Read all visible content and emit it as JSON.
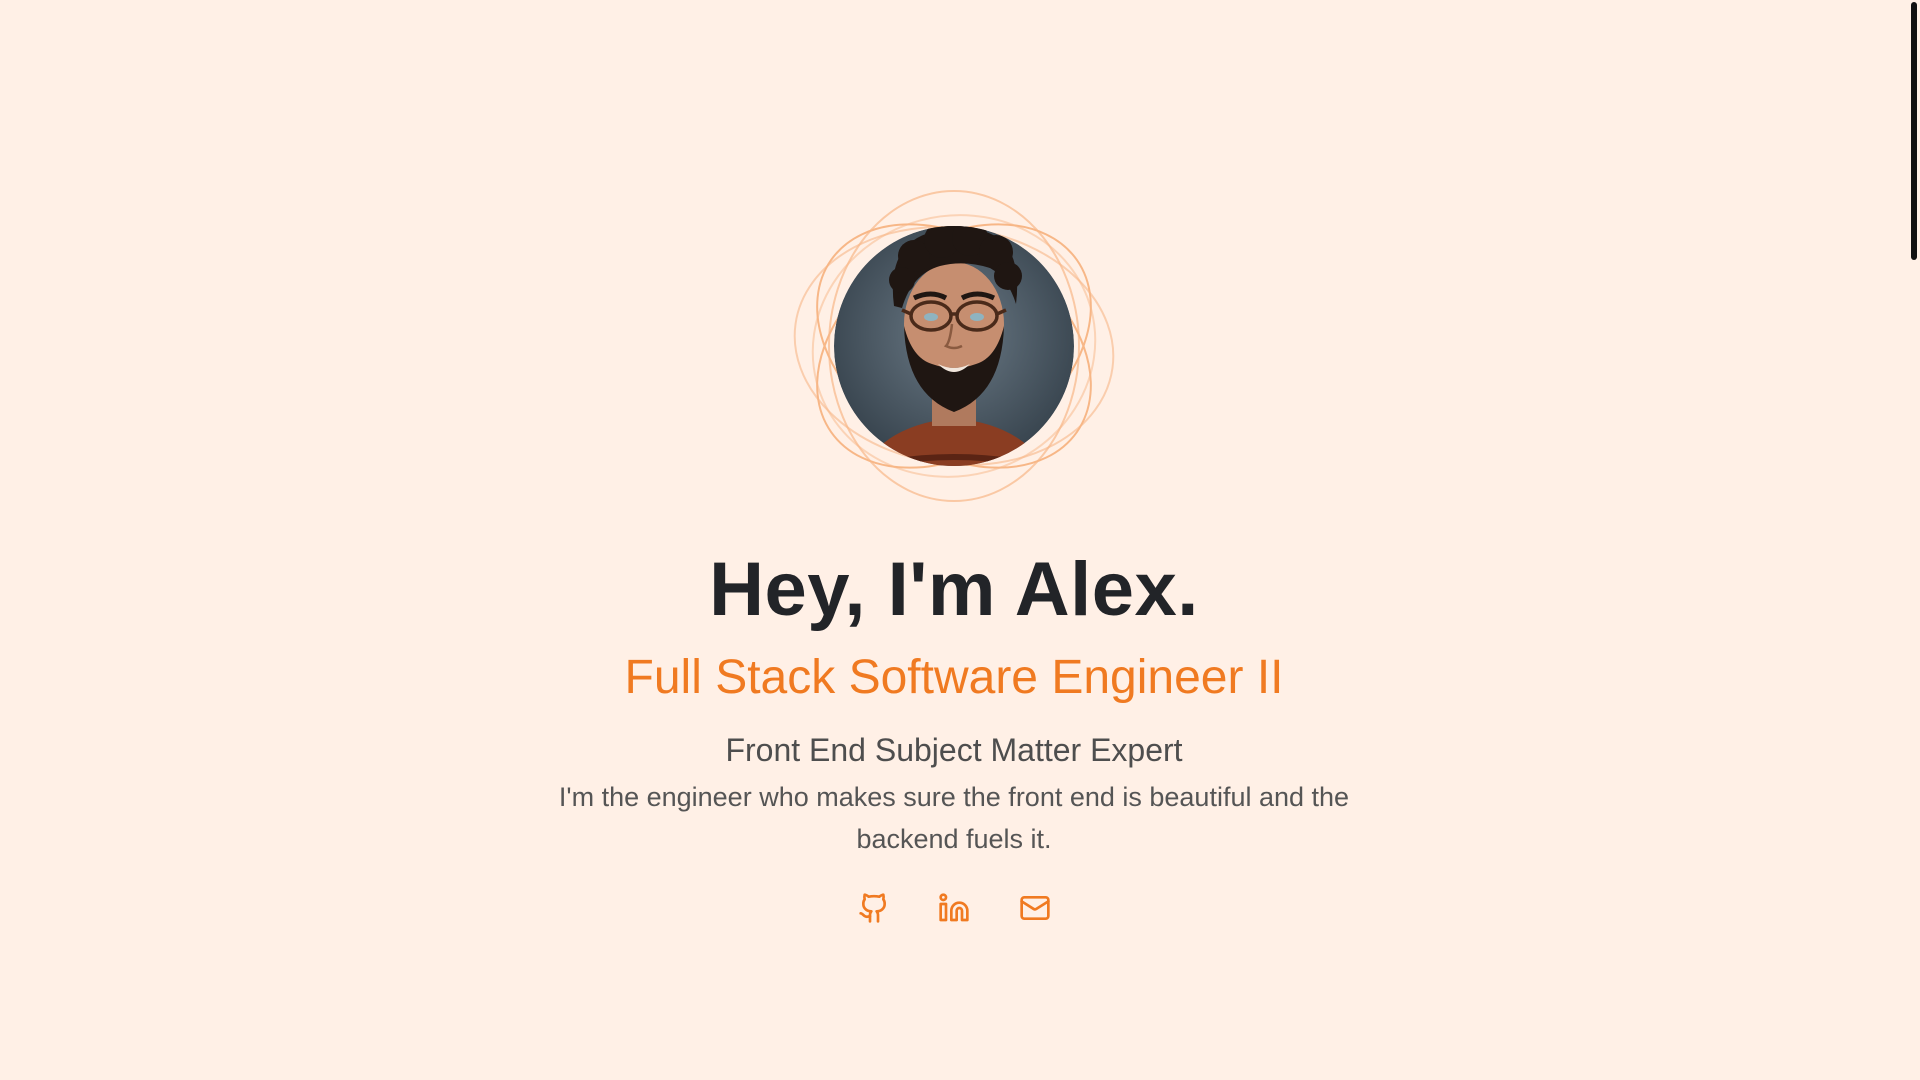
{
  "hero": {
    "title": "Hey, I'm Alex.",
    "subtitle": "Full Stack Software Engineer II",
    "tagline": "Front End Subject Matter Expert",
    "description": "I'm the engineer who makes sure the front end is beautiful and the backend fuels it."
  },
  "avatar": {
    "alt": "Illustrated portrait of Alex",
    "ring_color": "#f5a468"
  },
  "socials": [
    {
      "icon": "github-icon"
    },
    {
      "icon": "linkedin-icon"
    },
    {
      "icon": "mail-icon"
    }
  ],
  "colors": {
    "background": "#fff0e6",
    "accent": "#f07a21",
    "heading": "#222428",
    "body_text": "#555555"
  }
}
